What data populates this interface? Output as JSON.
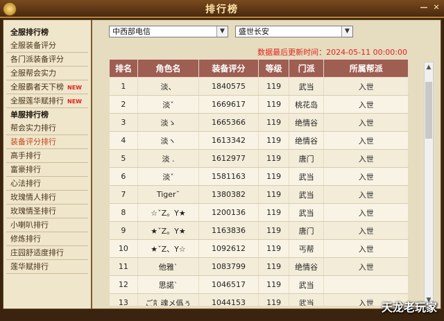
{
  "window": {
    "title": "排行榜",
    "minimize": "—",
    "close": "✕"
  },
  "sidebar": [
    {
      "label": "全服排行榜",
      "kind": "header"
    },
    {
      "label": "全服装备评分",
      "kind": "item"
    },
    {
      "label": "各门派装备评分",
      "kind": "item"
    },
    {
      "label": "全服帮会实力",
      "kind": "item"
    },
    {
      "label": "全服霸者天下榜",
      "kind": "item",
      "badge": "NEW"
    },
    {
      "label": "全服莲华赋排行",
      "kind": "item",
      "badge": "NEW"
    },
    {
      "label": "单服排行榜",
      "kind": "header"
    },
    {
      "label": "帮会实力排行",
      "kind": "item"
    },
    {
      "label": "装备评分排行",
      "kind": "item",
      "active": true
    },
    {
      "label": "高手排行",
      "kind": "item"
    },
    {
      "label": "富豪排行",
      "kind": "item"
    },
    {
      "label": "心法排行",
      "kind": "item"
    },
    {
      "label": "玫瑰情人排行",
      "kind": "item"
    },
    {
      "label": "玫瑰情圣排行",
      "kind": "item"
    },
    {
      "label": "小喇叭排行",
      "kind": "item"
    },
    {
      "label": "修炼排行",
      "kind": "item"
    },
    {
      "label": "庄园舒适度排行",
      "kind": "item"
    },
    {
      "label": "莲华赋排行",
      "kind": "item"
    }
  ],
  "filters": {
    "region": "中西部电信",
    "server": "盛世长安"
  },
  "update_text": "数据最后更新时间：2024-05-11 00:00:00",
  "table": {
    "headers": [
      "排名",
      "角色名",
      "装备评分",
      "等级",
      "门派",
      "所属帮派"
    ],
    "rows": [
      [
        "1",
        "淡、",
        "1840575",
        "119",
        "武当",
        "入世"
      ],
      [
        "2",
        "淡ˇ",
        "1669617",
        "119",
        "桃花岛",
        "入世"
      ],
      [
        "3",
        "淡ゝ",
        "1665366",
        "119",
        "绝情谷",
        "入世"
      ],
      [
        "4",
        "淡ヽ",
        "1613342",
        "119",
        "绝情谷",
        "入世"
      ],
      [
        "5",
        "淡 .",
        "1612977",
        "119",
        "唐门",
        "入世"
      ],
      [
        "6",
        "淡ˇ",
        "1581163",
        "119",
        "武当",
        "入世"
      ],
      [
        "7",
        "Tiger˘",
        "1380382",
        "119",
        "武当",
        "入世"
      ],
      [
        "8",
        "☆ˇZ。Y★",
        "1200136",
        "119",
        "武当",
        "入世"
      ],
      [
        "9",
        "★ˇZ。Y★",
        "1163836",
        "119",
        "唐门",
        "入世"
      ],
      [
        "10",
        "★ˇZ、Y☆",
        "1092612",
        "119",
        "丐帮",
        "入世"
      ],
      [
        "11",
        "他雅`",
        "1083799",
        "119",
        "绝情谷",
        "入世"
      ],
      [
        "12",
        "思諾`",
        "1046517",
        "119",
        "武当",
        ""
      ],
      [
        "13",
        "ご訁魂メ僞ぅ",
        "1044153",
        "119",
        "武当",
        "入世"
      ]
    ]
  },
  "watermark": "天龙老玩家",
  "colors": {
    "header_bg": "#9e5e52",
    "accent_red": "#e0231b",
    "frame": "#3a2410"
  }
}
